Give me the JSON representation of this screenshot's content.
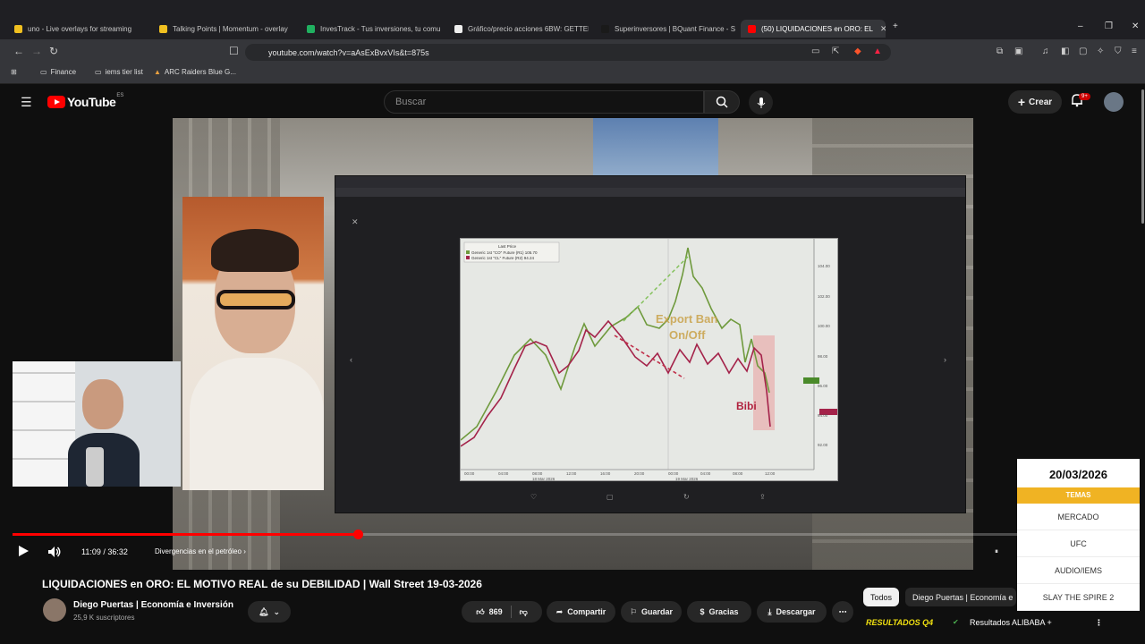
{
  "browser": {
    "tabs": [
      {
        "label": "uno - Live overlays for streaming",
        "color": "#f0c020"
      },
      {
        "label": "Talking Points | Momentum - overlay",
        "color": "#f0c020"
      },
      {
        "label": "InvesTrack - Tus inversiones, tu comu",
        "color": "#20b060"
      },
      {
        "label": "Gráfico/precio acciones 6BW: GETTER",
        "color": "#ffffff"
      },
      {
        "label": "Superinversores | BQuant Finance - S",
        "color": "#1a1a1a"
      },
      {
        "label": "(50) LIQUIDACIONES en ORO: EL",
        "color": "#ff0000"
      }
    ],
    "url": "youtube.com/watch?v=aAsExBvxVIs&t=875s",
    "bookmarks": [
      "Finance",
      "iems tier list",
      "ARC Raiders Blue G..."
    ]
  },
  "youtube": {
    "logo_text": "YouTube",
    "country": "ES",
    "search_placeholder": "Buscar",
    "create_label": "Crear",
    "notif_count": "9+"
  },
  "video": {
    "current_time": "11:09",
    "duration": "36:32",
    "time_display": "11:09 / 36:32",
    "progress": 0.305,
    "chapter": "Divergencias en el petróleo",
    "chart": {
      "legend_title": "Last Price",
      "legend_1": "Generic 1st \"CO\" Future (R1) 105.70",
      "legend_2": "Generic 1st \"CL\" Future (R2) 94.24",
      "annotation_1": "Export Ban",
      "annotation_2": "On/Off",
      "annotation_3": "Bibi",
      "x_ticks": [
        "00:00",
        "04:00",
        "08:00",
        "12:00",
        "16:00",
        "20:00",
        "00:00",
        "04:00",
        "08:00",
        "12:00"
      ],
      "date_1": "18 Mar 2026",
      "date_2": "19 Mar 2026",
      "y_ticks": [
        "104.00",
        "102.00",
        "100.00",
        "98.00",
        "96.00",
        "94.00",
        "92.00"
      ]
    }
  },
  "side_panel": {
    "date": "20/03/2026",
    "header": "TEMAS",
    "topics": [
      "MERCADO",
      "UFC",
      "AUDIO/IEMS",
      "SLAY THE SPIRE 2"
    ]
  },
  "details": {
    "title": "LIQUIDACIONES en ORO: EL MOTIVO REAL de su DEBILIDAD | Wall Street 19-03-2026",
    "channel": "Diego Puertas | Economía e Inversión",
    "subscribers": "25,9 K suscriptores",
    "likes": "869",
    "share": "Compartir",
    "save": "Guardar",
    "thanks": "Gracias",
    "download": "Descargar"
  },
  "chips": {
    "all": "Todos",
    "channel": "Diego Puertas | Economía e"
  },
  "results": {
    "left": "RESULTADOS Q4",
    "right": "Resultados ALIBABA +"
  }
}
